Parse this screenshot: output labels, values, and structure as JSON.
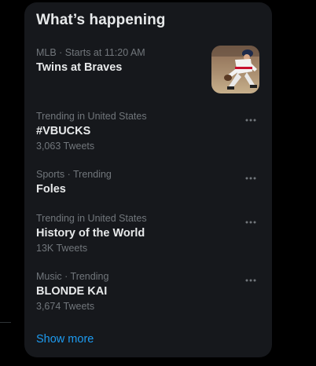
{
  "card": {
    "title": "What’s happening",
    "show_more": "Show more"
  },
  "trends": [
    {
      "meta": "MLB · Starts at 11:20 AM",
      "name": "Twins at Braves",
      "count": "",
      "has_image": true
    },
    {
      "meta": "Trending in United States",
      "name": "#VBUCKS",
      "count": "3,063 Tweets"
    },
    {
      "meta": "Sports · Trending",
      "name": "Foles",
      "count": ""
    },
    {
      "meta": "Trending in United States",
      "name": "History of the World",
      "count": "13K Tweets"
    },
    {
      "meta": "Music · Trending",
      "name": "BLONDE KAI",
      "count": "3,674 Tweets"
    }
  ],
  "colors": {
    "background": "#000000",
    "card": "#16181c",
    "primary_text": "#e7e9ea",
    "secondary_text": "#71767b",
    "accent": "#1d9bf0"
  },
  "icons": {
    "more": "more-horizontal-icon",
    "thumbnail": "baseball-player-photo"
  }
}
